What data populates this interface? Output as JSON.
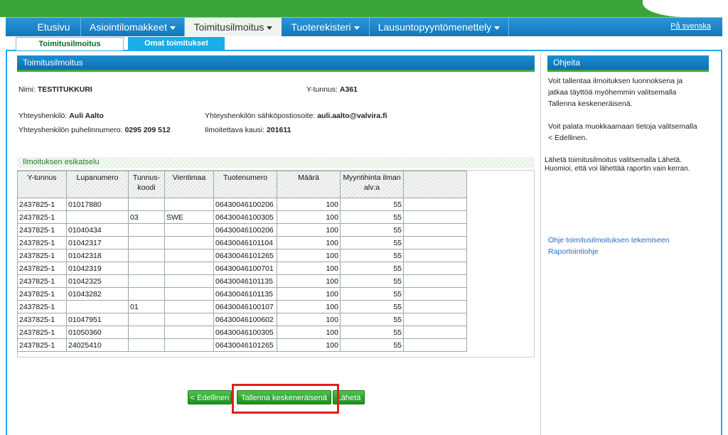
{
  "nav": {
    "items": [
      {
        "label": "Etusivu",
        "dropdown": false
      },
      {
        "label": "Asiointilomakkeet",
        "dropdown": true
      },
      {
        "label": "Toimitusilmoitus",
        "dropdown": true,
        "active": true
      },
      {
        "label": "Tuoterekisteri",
        "dropdown": true
      },
      {
        "label": "Lausuntopyyntömenettely",
        "dropdown": true
      }
    ],
    "language_link": "På svenska"
  },
  "subnav": {
    "active": "Toimitusilmoitus",
    "other": "Omat toimitukset"
  },
  "main": {
    "title": "Toimitusilmoitus",
    "name_label": "Nimi:",
    "name_value": "TESTITUKKURI",
    "ytunnus_label": "Y-tunnus:",
    "ytunnus_value": "A361",
    "contact_label": "Yhteyshenkilö:",
    "contact_value": "Auli Aalto",
    "email_label": "Yhteyshenkilön sähköpostiosoite:",
    "email_value": "auli.aalto@valvira.fi",
    "phone_label": "Yhteyshenkilön puhelinnumero:",
    "phone_value": "0295 209 512",
    "period_label": "Ilmoitettava kausi:",
    "period_value": "201611",
    "preview_title": "Ilmoituksen esikatselu"
  },
  "table": {
    "headers": [
      "Y-tunnus",
      "Lupanumero",
      "Tunnus-koodi",
      "Vientimaa",
      "Tuotenumero",
      "Määrä",
      "Myyntihinta ilman alv:a",
      ""
    ],
    "rows": [
      [
        "2437825-1",
        "01017880",
        "",
        "",
        "06430046100206",
        "100",
        "55",
        ""
      ],
      [
        "2437825-1",
        "",
        "03",
        "SWE",
        "06430046100305",
        "100",
        "55",
        ""
      ],
      [
        "2437825-1",
        "01040434",
        "",
        "",
        "06430046100206",
        "100",
        "55",
        ""
      ],
      [
        "2437825-1",
        "01042317",
        "",
        "",
        "06430046101104",
        "100",
        "55",
        ""
      ],
      [
        "2437825-1",
        "01042318",
        "",
        "",
        "06430046101265",
        "100",
        "55",
        ""
      ],
      [
        "2437825-1",
        "01042319",
        "",
        "",
        "06430046100701",
        "100",
        "55",
        ""
      ],
      [
        "2437825-1",
        "01042325",
        "",
        "",
        "06430046101135",
        "100",
        "55",
        ""
      ],
      [
        "2437825-1",
        "01043282",
        "",
        "",
        "06430046101135",
        "100",
        "55",
        ""
      ],
      [
        "2437825-1",
        "",
        "01",
        "",
        "06430046100107",
        "100",
        "55",
        ""
      ],
      [
        "2437825-1",
        "01047951",
        "",
        "",
        "06430046100602",
        "100",
        "55",
        ""
      ],
      [
        "2437825-1",
        "01050360",
        "",
        "",
        "06430046100305",
        "100",
        "55",
        ""
      ],
      [
        "2437825-1",
        "24025410",
        "",
        "",
        "06430046101265",
        "100",
        "55",
        ""
      ]
    ]
  },
  "buttons": {
    "previous": "< Edellinen",
    "save_draft": "Tallenna keskeneräisenä",
    "send": "Lähetä"
  },
  "help": {
    "title": "Ohjeita",
    "para1": [
      "Voit tallentaa ilmoituksen luonnoksena ja",
      "jatkaa täyttöä myöhemmin valitsemalla",
      "Tallenna keskeneräisenä."
    ],
    "para2": [
      "Voit palata muokkaamaan tietoja valitsemalla",
      "< Edellinen."
    ],
    "para3": [
      "Lähetä toimitusilmoitus valitsemalla Lähetä.",
      "Huomioi, että voi lähettää raportin vain kerran."
    ],
    "links": [
      "Ohje toimitusilmoituksen tekemiseen",
      "Raportointiohje"
    ]
  },
  "colors": {
    "brand_green": "#3aa63a",
    "nav_blue": "#1a8fd2",
    "highlight_red": "#e02020"
  }
}
